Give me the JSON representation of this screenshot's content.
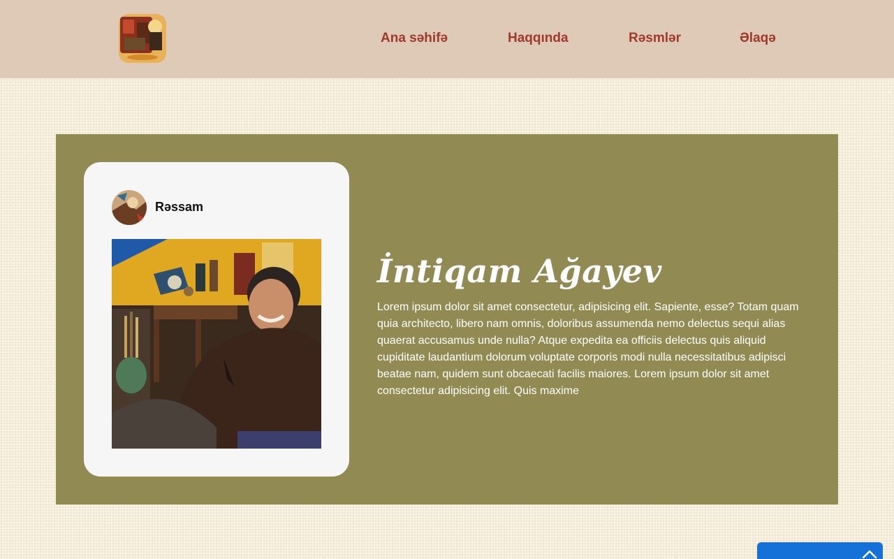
{
  "header": {
    "logo_icon": "art-studio-logo-icon",
    "nav": [
      {
        "label": "Ana səhifə"
      },
      {
        "label": "Haqqında"
      },
      {
        "label": "Rəsmlər"
      },
      {
        "label": "Əlaqə"
      }
    ]
  },
  "artist": {
    "card_label": "Rəssam",
    "avatar_icon": "artist-avatar-icon",
    "portrait_icon": "artist-portrait-image",
    "name": "İntiqam Ağayev",
    "bio": "Lorem ipsum dolor sit amet consectetur, adipisicing elit. Sapiente, esse? Totam quam quia architecto, libero nam omnis, doloribus assumenda nemo delectus sequi alias quaerat accusamus unde nulla? Atque expedita ea officiis delectus quis aliquid cupiditate laudantium dolorum voluptate corporis modi nulla necessitatibus adipisci beatae nam, quidem sunt obcaecati facilis maiores. Lorem ipsum dolor sit amet consectetur adipisicing elit. Quis maxime"
  },
  "widget": {
    "icon": "chevron-up-icon"
  },
  "colors": {
    "header_bg": "#dfc9b7",
    "nav_text": "#9f3a2a",
    "panel_bg": "#918a52",
    "card_bg": "#f6f6f6",
    "page_bg": "#f8f1e1",
    "widget_bg": "#1570d8"
  }
}
